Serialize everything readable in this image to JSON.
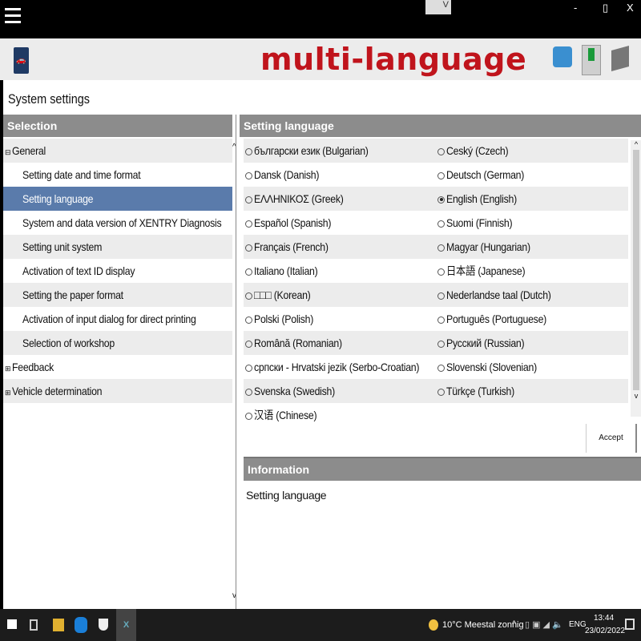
{
  "window": {
    "menu_icon": "hamburger-icon",
    "minimize": "-",
    "maximize": "▯",
    "close": "X",
    "ime": "V"
  },
  "banner": "multi-language",
  "colors": {
    "banner": "#c0141c",
    "selected": "#5a7bab",
    "header": "#8c8c8c"
  },
  "page_title": "System settings",
  "selection": {
    "header": "Selection",
    "items": [
      {
        "label": "General",
        "expander": "⊟",
        "level": 0
      },
      {
        "label": "Setting date and time format",
        "level": 1
      },
      {
        "label": "Setting language",
        "level": 1,
        "selected": true
      },
      {
        "label": "System and data version of XENTRY Diagnosis",
        "level": 1
      },
      {
        "label": "Setting unit system",
        "level": 1
      },
      {
        "label": "Activation of text ID display",
        "level": 1
      },
      {
        "label": "Setting the paper format",
        "level": 1
      },
      {
        "label": "Activation of input dialog for direct printing",
        "level": 1
      },
      {
        "label": "Selection of workshop",
        "level": 1
      },
      {
        "label": "Feedback",
        "expander": "⊞",
        "level": 0
      },
      {
        "label": "Vehicle determination",
        "expander": "⊞",
        "level": 0
      }
    ]
  },
  "language": {
    "header": "Setting language",
    "selected": "English (English)",
    "options": [
      "български език (Bulgarian)",
      "Ceský (Czech)",
      "Dansk (Danish)",
      "Deutsch (German)",
      "ΕΛΛΗΝΙΚΟΣ (Greek)",
      "English (English)",
      "Español (Spanish)",
      "Suomi (Finnish)",
      "Français (French)",
      "Magyar (Hungarian)",
      "Italiano (Italian)",
      "日本語 (Japanese)",
      "□□□ (Korean)",
      "Nederlandse taal (Dutch)",
      "Polski (Polish)",
      "Português (Portuguese)",
      "Română (Romanian)",
      "Русский (Russian)",
      "српски - Hrvatski jezik (Serbo-Croatian)",
      "Slovenski (Slovenian)",
      "Svenska (Swedish)",
      "Türkçe (Turkish)",
      "汉语 (Chinese)"
    ],
    "accept": "Accept"
  },
  "information": {
    "header": "Information",
    "text": "Setting language"
  },
  "taskbar": {
    "weather": "10°C  Meestal zonnig",
    "lang": "ENG",
    "time": "13:44",
    "date": "23/02/2022"
  }
}
